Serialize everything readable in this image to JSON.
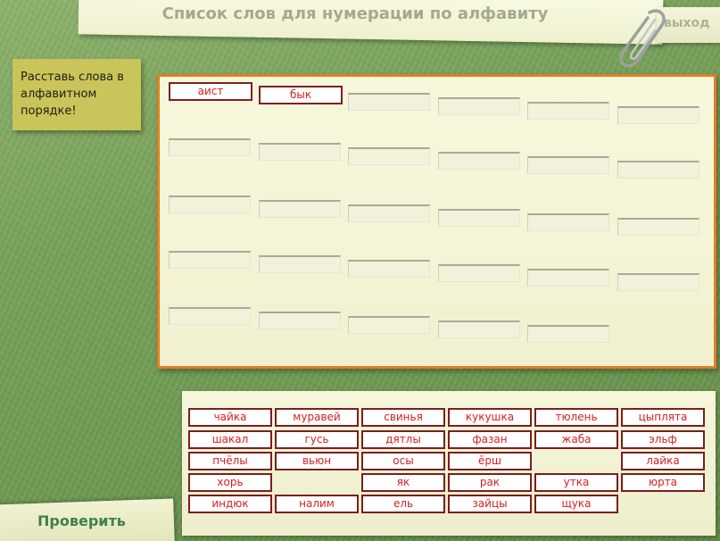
{
  "title": "Список слов для нумерации по алфавиту",
  "exit_label": "выход",
  "instruction": "Расставь слова в алфавитном порядке!",
  "board": {
    "placed": [
      "аист",
      "бык"
    ],
    "empty_slot_count": 28
  },
  "word_bank": {
    "rows": [
      [
        "чайка",
        "муравей",
        "свинья",
        "кукушка",
        "тюлень",
        "цыплята"
      ],
      [
        "шакал",
        "гусь",
        "дятлы",
        "фазан",
        "жаба",
        "эльф"
      ],
      [
        "пчёлы",
        "вьюн",
        "осы",
        "ёрш",
        "",
        "лайка"
      ],
      [
        "хорь",
        "",
        "як",
        "рак",
        "утка",
        "юрта"
      ],
      [
        "индюк",
        "налим",
        "ель",
        "зайцы",
        "щука",
        ""
      ]
    ]
  },
  "check_label": "Проверить",
  "colors": {
    "background": "#76a058",
    "board_border": "#e08020",
    "word_text": "#d61f1f",
    "check_text": "#3f8048"
  },
  "icons": [
    "paperclip-icon"
  ]
}
